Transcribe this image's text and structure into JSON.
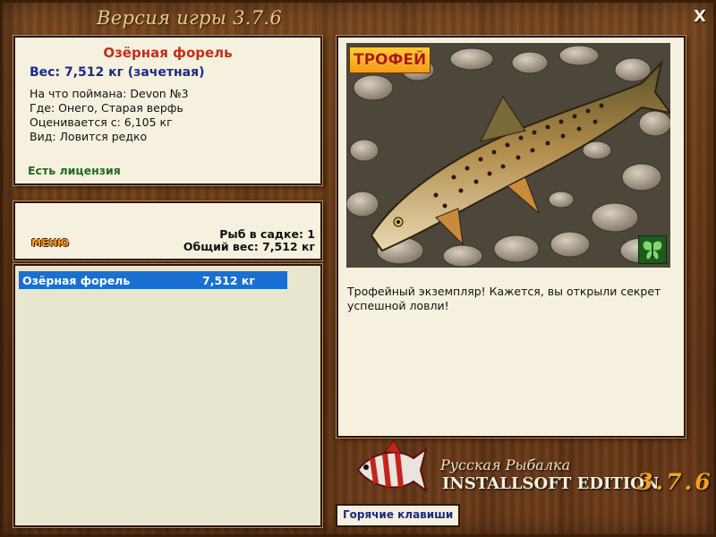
{
  "window": {
    "version_title": "Версия игры 3.7.6",
    "close_label": "X"
  },
  "fish_info": {
    "name": "Озёрная форель",
    "weight": "Вес: 7,512 кг (зачетная)",
    "bait": "На что поймана: Devon №3",
    "location": "Где: Онего, Старая верфь",
    "min_weight": "Оценивается с: 6,105 кг",
    "rarity": "Вид: Ловится редко",
    "license": "Есть лицензия"
  },
  "catch_panel": {
    "menu_label": "МЕНЮ",
    "fish_count": "Рыб в садке: 1",
    "total_weight": "Общий вес: 7,512 кг"
  },
  "catch_list": [
    {
      "name": "Озёрная форель",
      "weight": "7,512 кг",
      "selected": true
    }
  ],
  "photo_panel": {
    "badge": "ТРОФЕЙ",
    "description": "Трофейный экземпляр! Кажется, вы открыли секрет успешной ловли!",
    "icon": "butterfly-icon"
  },
  "logo": {
    "title": "Русская Рыбалка",
    "edition": "INSTALLSOFT EDITION",
    "version": "3.7.6"
  },
  "footer": {
    "hotkeys_label": "Горячие клавиши"
  },
  "colors": {
    "fish_name": "#c0301a",
    "weight": "#1a2a8a",
    "license": "#1f6b1f",
    "selection": "#1a6fd2",
    "accent": "#f2a21c"
  }
}
